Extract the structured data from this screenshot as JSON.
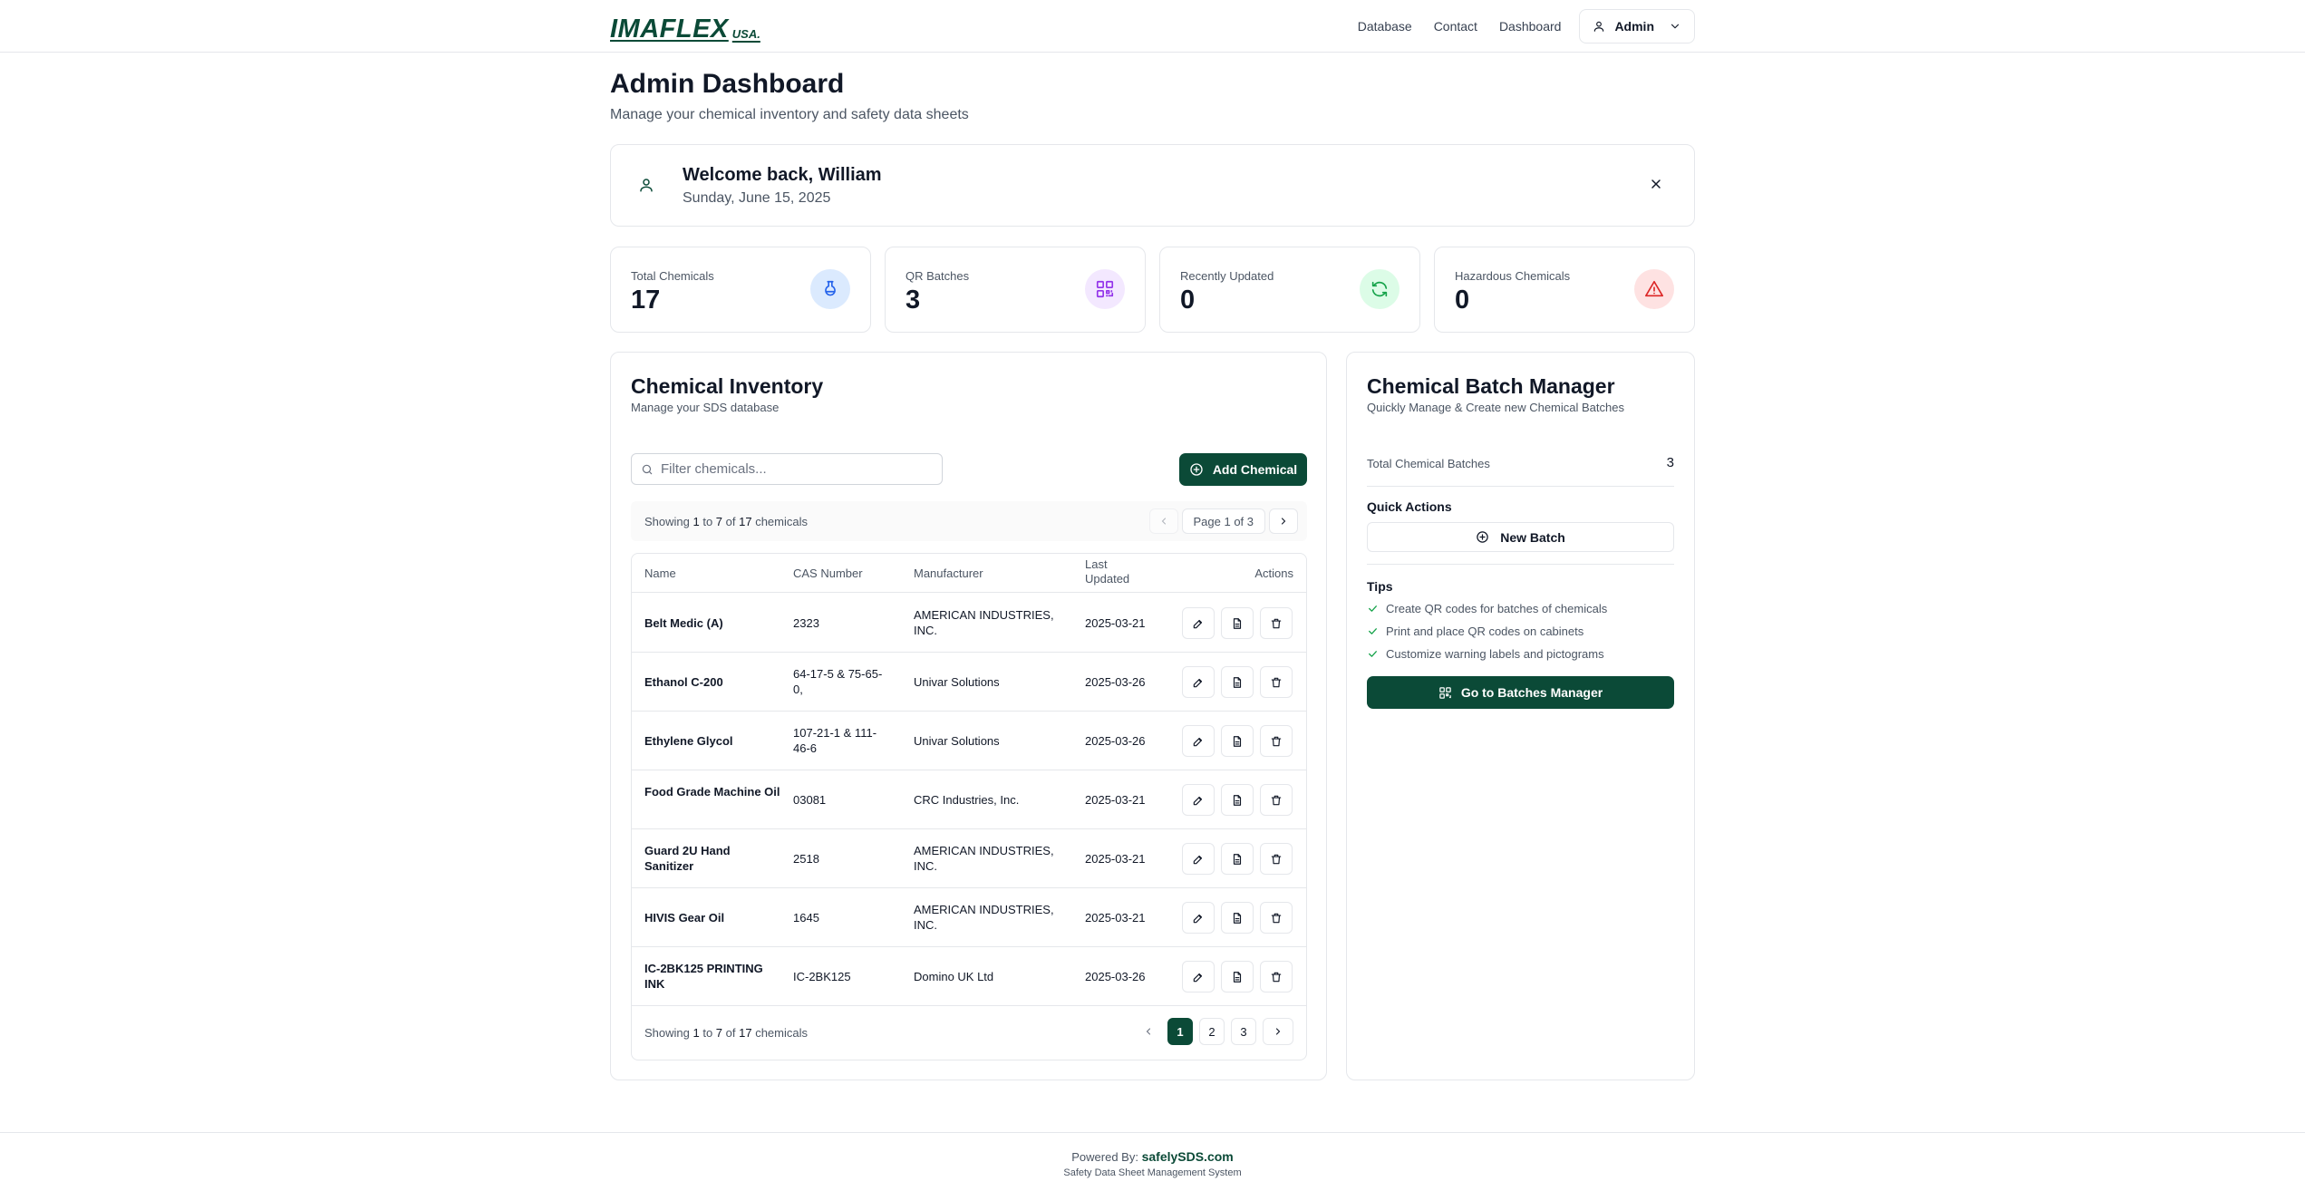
{
  "nav": {
    "logo_main": "IMAFLEX",
    "logo_sub": "USA.",
    "links": [
      "Database",
      "Contact",
      "Dashboard"
    ],
    "user_label": "Admin"
  },
  "header": {
    "title": "Admin Dashboard",
    "subtitle": "Manage your chemical inventory and safety data sheets"
  },
  "welcome": {
    "title": "Welcome back, William",
    "date": "Sunday, June 15, 2025"
  },
  "stats": [
    {
      "label": "Total Chemicals",
      "value": "17",
      "icon": "flask-icon",
      "color": "#2563eb",
      "bg": "#dbeafe"
    },
    {
      "label": "QR Batches",
      "value": "3",
      "icon": "qr-code-icon",
      "color": "#9333ea",
      "bg": "#f3e8ff"
    },
    {
      "label": "Recently Updated",
      "value": "0",
      "icon": "refresh-icon",
      "color": "#16a34a",
      "bg": "#dcfce7"
    },
    {
      "label": "Hazardous Chemicals",
      "value": "0",
      "icon": "warning-icon",
      "color": "#dc2626",
      "bg": "#fee2e2"
    }
  ],
  "inventory": {
    "title": "Chemical Inventory",
    "subtitle": "Manage your SDS database",
    "filter_placeholder": "Filter chemicals...",
    "add_label": "Add Chemical",
    "showing": {
      "prefix": "Showing ",
      "from": "1",
      "mid1": " to ",
      "to": "7",
      "mid2": " of ",
      "total": "17",
      "suffix": " chemicals"
    },
    "page_label": "Page 1 of 3",
    "columns": {
      "name": "Name",
      "cas": "CAS Number",
      "manufacturer": "Manufacturer",
      "last_updated_1": "Last",
      "last_updated_2": "Updated",
      "actions": "Actions"
    },
    "rows": [
      {
        "name": "Belt Medic (A)",
        "cas": "2323",
        "manufacturer": "AMERICAN INDUSTRIES, INC.",
        "updated": "2025-03-21"
      },
      {
        "name": "Ethanol C-200",
        "cas": "64-17-5 & 75-65-0,",
        "manufacturer": "Univar Solutions",
        "updated": "2025-03-26"
      },
      {
        "name": "Ethylene Glycol",
        "cas": "107-21-1 & 111-46-6",
        "manufacturer": "Univar Solutions",
        "updated": "2025-03-26"
      },
      {
        "name": "Food Grade Machine Oil",
        "cas": "03081",
        "manufacturer": "CRC Industries, Inc.",
        "updated": "2025-03-21"
      },
      {
        "name": "Guard 2U Hand Sanitizer",
        "cas": "2518",
        "manufacturer": "AMERICAN INDUSTRIES, INC.",
        "updated": "2025-03-21"
      },
      {
        "name": "HIVIS Gear Oil",
        "cas": "1645",
        "manufacturer": "AMERICAN INDUSTRIES, INC.",
        "updated": "2025-03-21"
      },
      {
        "name": "IC-2BK125 PRINTING INK",
        "cas": "IC-2BK125",
        "manufacturer": "Domino UK Ltd",
        "updated": "2025-03-26"
      }
    ],
    "pages": [
      "1",
      "2",
      "3"
    ]
  },
  "batch": {
    "title": "Chemical Batch Manager",
    "subtitle": "Quickly Manage & Create new Chemical Batches",
    "total_label": "Total Chemical Batches",
    "total_value": "3",
    "quick_actions": "Quick Actions",
    "new_batch": "New Batch",
    "tips_title": "Tips",
    "tips": [
      "Create QR codes for batches of chemicals",
      "Print and place QR codes on cabinets",
      "Customize warning labels and pictograms"
    ],
    "go_label": "Go to Batches Manager"
  },
  "footer": {
    "powered_prefix": "Powered By: ",
    "brand": "safelySDS.com",
    "sub": "Safety Data Sheet Management System"
  },
  "colors": {
    "brand": "#0b4a37",
    "check": "#16a34a"
  }
}
